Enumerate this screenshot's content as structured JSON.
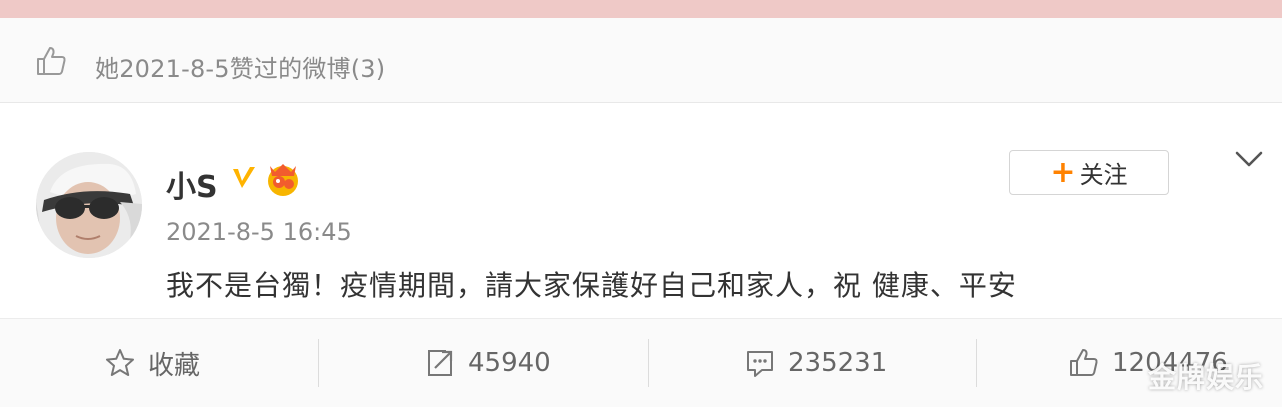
{
  "liked_header": {
    "text": "她2021-8-5赞过的微博(3)",
    "icon": "thumbs-up-icon"
  },
  "post": {
    "author": "小S",
    "verified_icon": "verified-v-icon",
    "badge_icon": "crown-badge-icon",
    "timestamp": "2021-8-5 16:45",
    "content": "我不是台獨！疫情期間，請大家保護好自己和家人，祝 健康、平安"
  },
  "follow_button": {
    "plus": "+",
    "label": "关注"
  },
  "actions": {
    "favorite": {
      "icon": "star-icon",
      "label": "收藏"
    },
    "repost": {
      "icon": "repost-icon",
      "count": "45940"
    },
    "comment": {
      "icon": "comment-icon",
      "count": "235231"
    },
    "like": {
      "icon": "thumbs-up-icon",
      "count": "1204476"
    }
  },
  "watermark": "金牌娱乐",
  "colors": {
    "accent": "#ff8200",
    "top_strip": "#efc9c7",
    "verified": "#ffb300",
    "badge": "#f25c2e"
  }
}
